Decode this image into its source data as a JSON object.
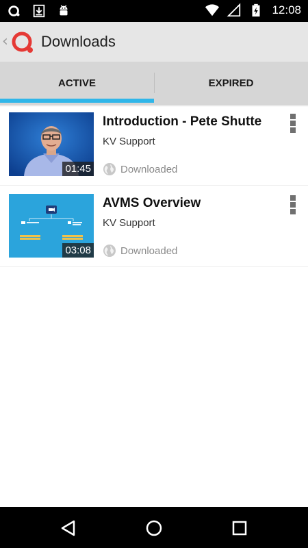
{
  "status_bar": {
    "time": "12:08",
    "left_icons": [
      "app-notification-icon",
      "download-icon",
      "android-debug-icon"
    ],
    "right_icons": [
      "wifi-icon",
      "signal-icon",
      "battery-charging-icon"
    ]
  },
  "app_bar": {
    "title": "Downloads",
    "back_icon": "back-chevron-icon",
    "logo_icon": "app-logo-icon"
  },
  "tabs": [
    {
      "label": "ACTIVE",
      "selected": true
    },
    {
      "label": "EXPIRED",
      "selected": false
    }
  ],
  "accent_color": "#2fb6e9",
  "downloads": [
    {
      "title": "Introduction - Pete Shutte",
      "subtitle": "KV Support",
      "duration": "01:45",
      "status": "Downloaded"
    },
    {
      "title": "AVMS Overview",
      "subtitle": "KV Support",
      "duration": "03:08",
      "status": "Downloaded"
    }
  ],
  "nav_bar": {
    "buttons": [
      "back-nav-icon",
      "home-nav-icon",
      "recents-nav-icon"
    ]
  }
}
